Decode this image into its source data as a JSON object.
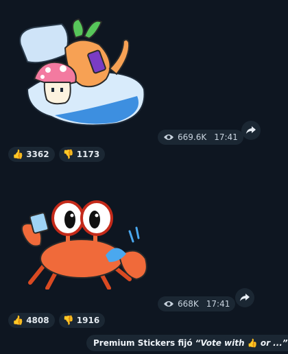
{
  "messages": [
    {
      "sticker": "mushroom-and-carrot-in-bed",
      "views": "669.6K",
      "time": "17:41",
      "reactions": [
        {
          "emoji": "👍",
          "count": "3362"
        },
        {
          "emoji": "👎",
          "count": "1173"
        }
      ]
    },
    {
      "sticker": "crab-drinking-water",
      "views": "668K",
      "time": "17:41",
      "reactions": [
        {
          "emoji": "👍",
          "count": "4808"
        },
        {
          "emoji": "👎",
          "count": "1916"
        }
      ]
    }
  ],
  "poll_preview": {
    "channel": "Premium Stickers fijó",
    "quote_prefix": "“Vote with ",
    "quote_emoji": "👍",
    "quote_suffix": " or ...”"
  },
  "icons": {
    "views": "eye-icon",
    "share": "share-arrow-icon"
  },
  "colors": {
    "background": "#0e1621",
    "pill": "#1b2733"
  }
}
